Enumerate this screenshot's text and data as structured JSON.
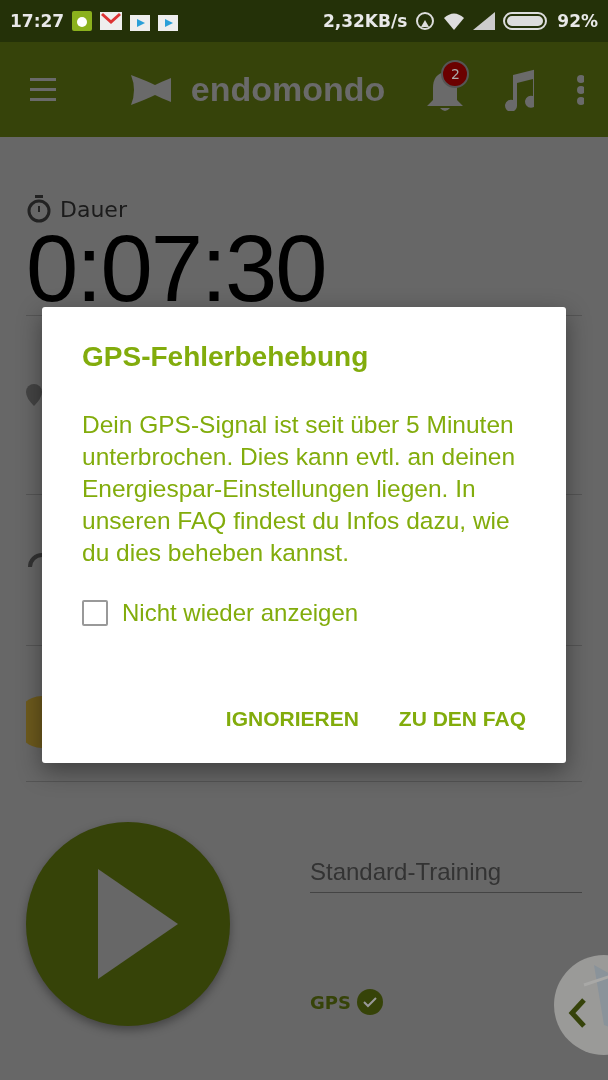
{
  "status_bar": {
    "time": "17:27",
    "speed": "2,32KB/s",
    "battery": "92%"
  },
  "app_bar": {
    "logo": "endomondo",
    "notification_count": "2"
  },
  "workout": {
    "duration_label": "Dauer",
    "duration_value": "0:07:30",
    "training_type": "Standard-Training",
    "gps_label": "GPS",
    "gps_ok": true
  },
  "dialog": {
    "title": "GPS-Fehlerbehebung",
    "message": "Dein GPS-Signal ist seit über 5 Minuten unterbrochen. Dies kann evtl. an deinen Energiespar-Einstellungen liegen. In unseren FAQ findest du Infos dazu, wie du dies beheben kannst.",
    "checkbox": {
      "label": "Nicht wieder anzeigen",
      "checked": false
    },
    "buttons": [
      "IGNORIEREN",
      "ZU DEN FAQ"
    ]
  }
}
